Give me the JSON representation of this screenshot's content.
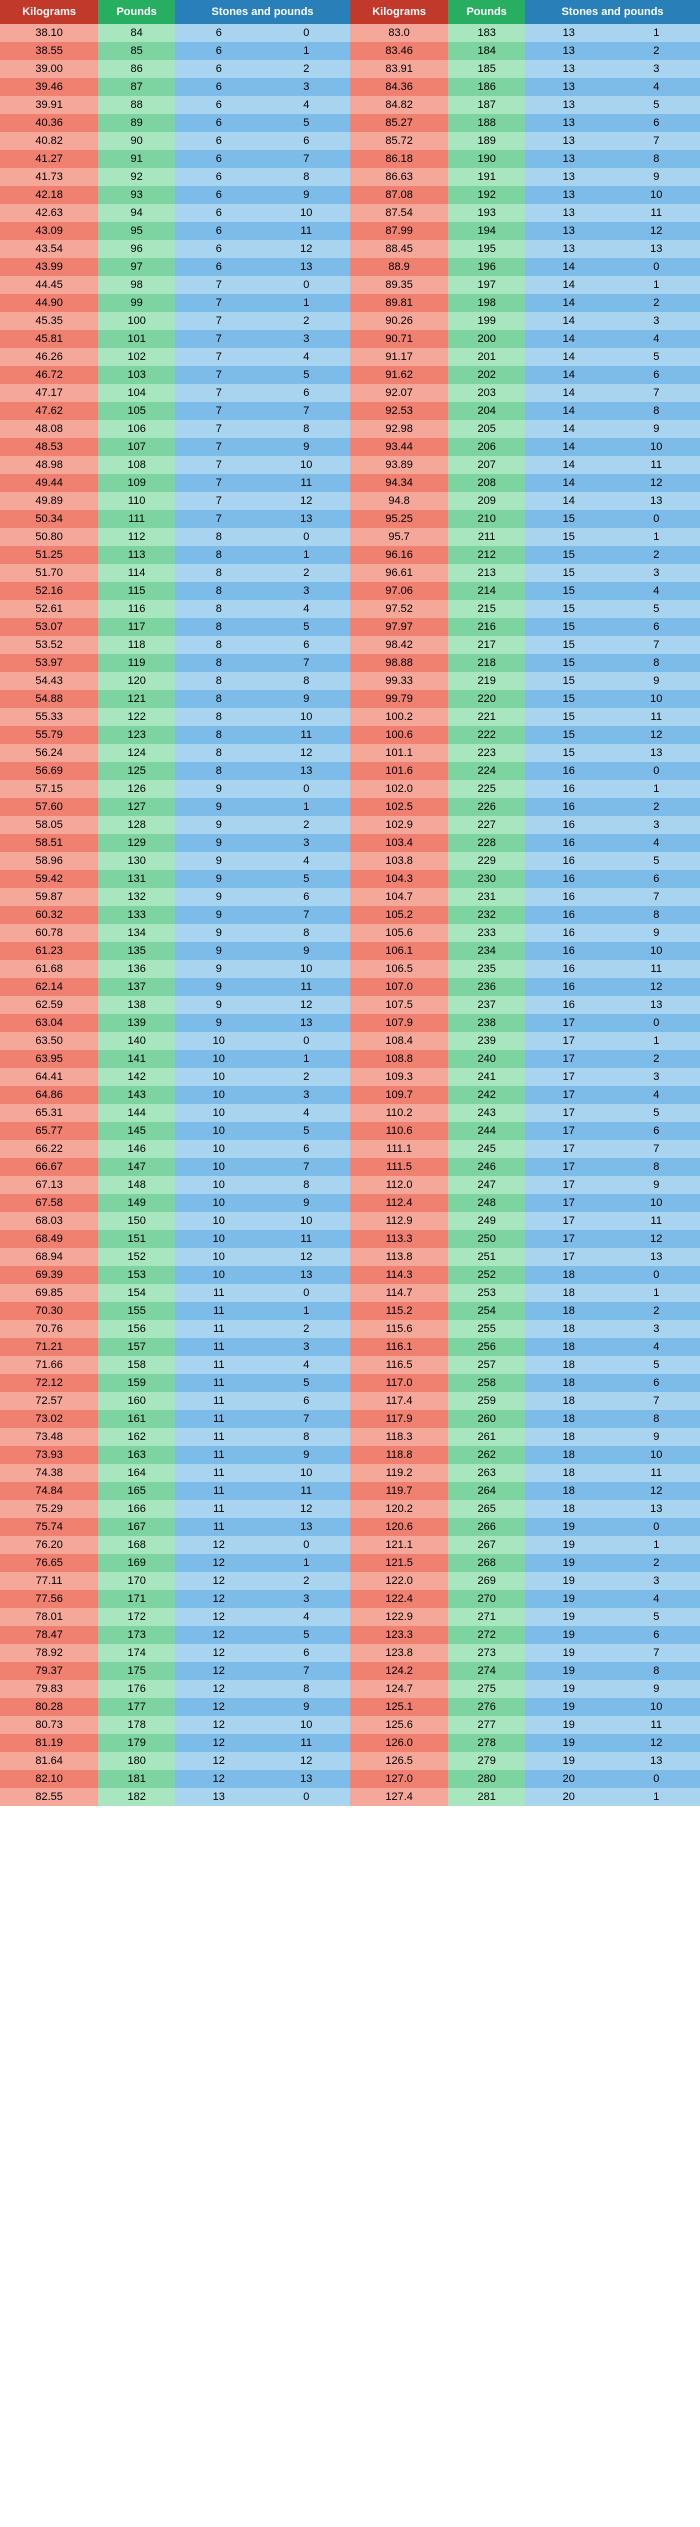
{
  "headers": {
    "kg": "Kilograms",
    "lbs": "Pounds",
    "st": "Stones and pounds"
  },
  "left_rows": [
    [
      38.1,
      84,
      6,
      0
    ],
    [
      38.55,
      85,
      6,
      1
    ],
    [
      39.0,
      86,
      6,
      2
    ],
    [
      39.46,
      87,
      6,
      3
    ],
    [
      39.91,
      88,
      6,
      4
    ],
    [
      40.36,
      89,
      6,
      5
    ],
    [
      40.82,
      90,
      6,
      6
    ],
    [
      41.27,
      91,
      6,
      7
    ],
    [
      41.73,
      92,
      6,
      8
    ],
    [
      42.18,
      93,
      6,
      9
    ],
    [
      42.63,
      94,
      6,
      10
    ],
    [
      43.09,
      95,
      6,
      11
    ],
    [
      43.54,
      96,
      6,
      12
    ],
    [
      43.99,
      97,
      6,
      13
    ],
    [
      44.45,
      98,
      7,
      0
    ],
    [
      44.9,
      99,
      7,
      1
    ],
    [
      45.35,
      100,
      7,
      2
    ],
    [
      45.81,
      101,
      7,
      3
    ],
    [
      46.26,
      102,
      7,
      4
    ],
    [
      46.72,
      103,
      7,
      5
    ],
    [
      47.17,
      104,
      7,
      6
    ],
    [
      47.62,
      105,
      7,
      7
    ],
    [
      48.08,
      106,
      7,
      8
    ],
    [
      48.53,
      107,
      7,
      9
    ],
    [
      48.98,
      108,
      7,
      10
    ],
    [
      49.44,
      109,
      7,
      11
    ],
    [
      49.89,
      110,
      7,
      12
    ],
    [
      50.34,
      111,
      7,
      13
    ],
    [
      50.8,
      112,
      8,
      0
    ],
    [
      51.25,
      113,
      8,
      1
    ],
    [
      51.7,
      114,
      8,
      2
    ],
    [
      52.16,
      115,
      8,
      3
    ],
    [
      52.61,
      116,
      8,
      4
    ],
    [
      53.07,
      117,
      8,
      5
    ],
    [
      53.52,
      118,
      8,
      6
    ],
    [
      53.97,
      119,
      8,
      7
    ],
    [
      54.43,
      120,
      8,
      8
    ],
    [
      54.88,
      121,
      8,
      9
    ],
    [
      55.33,
      122,
      8,
      10
    ],
    [
      55.79,
      123,
      8,
      11
    ],
    [
      56.24,
      124,
      8,
      12
    ],
    [
      56.69,
      125,
      8,
      13
    ],
    [
      57.15,
      126,
      9,
      0
    ],
    [
      57.6,
      127,
      9,
      1
    ],
    [
      58.05,
      128,
      9,
      2
    ],
    [
      58.51,
      129,
      9,
      3
    ],
    [
      58.96,
      130,
      9,
      4
    ],
    [
      59.42,
      131,
      9,
      5
    ],
    [
      59.87,
      132,
      9,
      6
    ],
    [
      60.32,
      133,
      9,
      7
    ],
    [
      60.78,
      134,
      9,
      8
    ],
    [
      61.23,
      135,
      9,
      9
    ],
    [
      61.68,
      136,
      9,
      10
    ],
    [
      62.14,
      137,
      9,
      11
    ],
    [
      62.59,
      138,
      9,
      12
    ],
    [
      63.04,
      139,
      9,
      13
    ],
    [
      63.5,
      140,
      10,
      0
    ],
    [
      63.95,
      141,
      10,
      1
    ],
    [
      64.41,
      142,
      10,
      2
    ],
    [
      64.86,
      143,
      10,
      3
    ],
    [
      65.31,
      144,
      10,
      4
    ],
    [
      65.77,
      145,
      10,
      5
    ],
    [
      66.22,
      146,
      10,
      6
    ],
    [
      66.67,
      147,
      10,
      7
    ],
    [
      67.13,
      148,
      10,
      8
    ],
    [
      67.58,
      149,
      10,
      9
    ],
    [
      68.03,
      150,
      10,
      10
    ],
    [
      68.49,
      151,
      10,
      11
    ],
    [
      68.94,
      152,
      10,
      12
    ],
    [
      69.39,
      153,
      10,
      13
    ],
    [
      69.85,
      154,
      11,
      0
    ],
    [
      70.3,
      155,
      11,
      1
    ],
    [
      70.76,
      156,
      11,
      2
    ],
    [
      71.21,
      157,
      11,
      3
    ],
    [
      71.66,
      158,
      11,
      4
    ],
    [
      72.12,
      159,
      11,
      5
    ],
    [
      72.57,
      160,
      11,
      6
    ],
    [
      73.02,
      161,
      11,
      7
    ],
    [
      73.48,
      162,
      11,
      8
    ],
    [
      73.93,
      163,
      11,
      9
    ],
    [
      74.38,
      164,
      11,
      10
    ],
    [
      74.84,
      165,
      11,
      11
    ],
    [
      75.29,
      166,
      11,
      12
    ],
    [
      75.74,
      167,
      11,
      13
    ],
    [
      76.2,
      168,
      12,
      0
    ],
    [
      76.65,
      169,
      12,
      1
    ],
    [
      77.11,
      170,
      12,
      2
    ],
    [
      77.56,
      171,
      12,
      3
    ],
    [
      78.01,
      172,
      12,
      4
    ],
    [
      78.47,
      173,
      12,
      5
    ],
    [
      78.92,
      174,
      12,
      6
    ],
    [
      79.37,
      175,
      12,
      7
    ],
    [
      79.83,
      176,
      12,
      8
    ],
    [
      80.28,
      177,
      12,
      9
    ],
    [
      80.73,
      178,
      12,
      10
    ],
    [
      81.19,
      179,
      12,
      11
    ],
    [
      81.64,
      180,
      12,
      12
    ],
    [
      82.1,
      181,
      12,
      13
    ],
    [
      82.55,
      182,
      13,
      0
    ]
  ],
  "right_rows": [
    [
      83.0,
      183,
      13,
      1
    ],
    [
      83.46,
      184,
      13,
      2
    ],
    [
      83.91,
      185,
      13,
      3
    ],
    [
      84.36,
      186,
      13,
      4
    ],
    [
      84.82,
      187,
      13,
      5
    ],
    [
      85.27,
      188,
      13,
      6
    ],
    [
      85.72,
      189,
      13,
      7
    ],
    [
      86.18,
      190,
      13,
      8
    ],
    [
      86.63,
      191,
      13,
      9
    ],
    [
      87.08,
      192,
      13,
      10
    ],
    [
      87.54,
      193,
      13,
      11
    ],
    [
      87.99,
      194,
      13,
      12
    ],
    [
      88.45,
      195,
      13,
      13
    ],
    [
      88.9,
      196,
      14,
      0
    ],
    [
      89.35,
      197,
      14,
      1
    ],
    [
      89.81,
      198,
      14,
      2
    ],
    [
      90.26,
      199,
      14,
      3
    ],
    [
      90.71,
      200,
      14,
      4
    ],
    [
      91.17,
      201,
      14,
      5
    ],
    [
      91.62,
      202,
      14,
      6
    ],
    [
      92.07,
      203,
      14,
      7
    ],
    [
      92.53,
      204,
      14,
      8
    ],
    [
      92.98,
      205,
      14,
      9
    ],
    [
      93.44,
      206,
      14,
      10
    ],
    [
      93.89,
      207,
      14,
      11
    ],
    [
      94.34,
      208,
      14,
      12
    ],
    [
      94.8,
      209,
      14,
      13
    ],
    [
      95.25,
      210,
      15,
      0
    ],
    [
      95.7,
      211,
      15,
      1
    ],
    [
      96.16,
      212,
      15,
      2
    ],
    [
      96.61,
      213,
      15,
      3
    ],
    [
      97.06,
      214,
      15,
      4
    ],
    [
      97.52,
      215,
      15,
      5
    ],
    [
      97.97,
      216,
      15,
      6
    ],
    [
      98.42,
      217,
      15,
      7
    ],
    [
      98.88,
      218,
      15,
      8
    ],
    [
      99.33,
      219,
      15,
      9
    ],
    [
      99.79,
      220,
      15,
      10
    ],
    [
      100.2,
      221,
      15,
      11
    ],
    [
      100.6,
      222,
      15,
      12
    ],
    [
      101.1,
      223,
      15,
      13
    ],
    [
      101.6,
      224,
      16,
      0
    ],
    [
      102.0,
      225,
      16,
      1
    ],
    [
      102.5,
      226,
      16,
      2
    ],
    [
      102.9,
      227,
      16,
      3
    ],
    [
      103.4,
      228,
      16,
      4
    ],
    [
      103.8,
      229,
      16,
      5
    ],
    [
      104.3,
      230,
      16,
      6
    ],
    [
      104.7,
      231,
      16,
      7
    ],
    [
      105.2,
      232,
      16,
      8
    ],
    [
      105.6,
      233,
      16,
      9
    ],
    [
      106.1,
      234,
      16,
      10
    ],
    [
      106.5,
      235,
      16,
      11
    ],
    [
      107.0,
      236,
      16,
      12
    ],
    [
      107.5,
      237,
      16,
      13
    ],
    [
      107.9,
      238,
      17,
      0
    ],
    [
      108.4,
      239,
      17,
      1
    ],
    [
      108.8,
      240,
      17,
      2
    ],
    [
      109.3,
      241,
      17,
      3
    ],
    [
      109.7,
      242,
      17,
      4
    ],
    [
      110.2,
      243,
      17,
      5
    ],
    [
      110.6,
      244,
      17,
      6
    ],
    [
      111.1,
      245,
      17,
      7
    ],
    [
      111.5,
      246,
      17,
      8
    ],
    [
      112.0,
      247,
      17,
      9
    ],
    [
      112.4,
      248,
      17,
      10
    ],
    [
      112.9,
      249,
      17,
      11
    ],
    [
      113.3,
      250,
      17,
      12
    ],
    [
      113.8,
      251,
      17,
      13
    ],
    [
      114.3,
      252,
      18,
      0
    ],
    [
      114.7,
      253,
      18,
      1
    ],
    [
      115.2,
      254,
      18,
      2
    ],
    [
      115.6,
      255,
      18,
      3
    ],
    [
      116.1,
      256,
      18,
      4
    ],
    [
      116.5,
      257,
      18,
      5
    ],
    [
      117.0,
      258,
      18,
      6
    ],
    [
      117.4,
      259,
      18,
      7
    ],
    [
      117.9,
      260,
      18,
      8
    ],
    [
      118.3,
      261,
      18,
      9
    ],
    [
      118.8,
      262,
      18,
      10
    ],
    [
      119.2,
      263,
      18,
      11
    ],
    [
      119.7,
      264,
      18,
      12
    ],
    [
      120.2,
      265,
      18,
      13
    ],
    [
      120.6,
      266,
      19,
      0
    ],
    [
      121.1,
      267,
      19,
      1
    ],
    [
      121.5,
      268,
      19,
      2
    ],
    [
      122.0,
      269,
      19,
      3
    ],
    [
      122.4,
      270,
      19,
      4
    ],
    [
      122.9,
      271,
      19,
      5
    ],
    [
      123.3,
      272,
      19,
      6
    ],
    [
      123.8,
      273,
      19,
      7
    ],
    [
      124.2,
      274,
      19,
      8
    ],
    [
      124.7,
      275,
      19,
      9
    ],
    [
      125.1,
      276,
      19,
      10
    ],
    [
      125.6,
      277,
      19,
      11
    ],
    [
      126.0,
      278,
      19,
      12
    ],
    [
      126.5,
      279,
      19,
      13
    ],
    [
      127.0,
      280,
      20,
      0
    ],
    [
      127.4,
      281,
      20,
      1
    ]
  ]
}
